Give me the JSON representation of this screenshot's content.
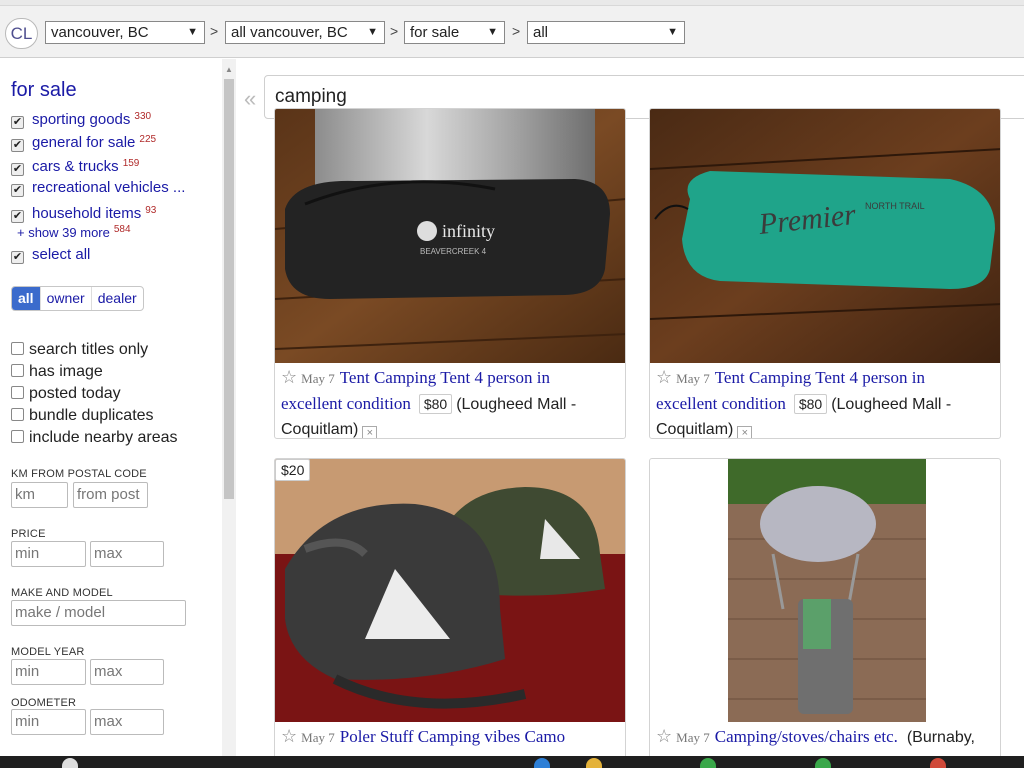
{
  "header": {
    "logo": "CL",
    "location": "vancouver, BC",
    "area": "all vancouver, BC",
    "category": "for sale",
    "subcategory": "all",
    "separator": ">",
    "dropdown_arrow": "▼"
  },
  "sidebar": {
    "title": "for sale",
    "categories": [
      {
        "label": "sporting goods",
        "count": "330"
      },
      {
        "label": "general for sale",
        "count": "225"
      },
      {
        "label": "cars & trucks",
        "count": "159"
      },
      {
        "label": "recreational vehicles ...",
        "count": ""
      },
      {
        "label": "household items",
        "count": "93"
      }
    ],
    "show_more": "+ show 39 more",
    "show_more_count": "584",
    "select_all": "select all",
    "seller_types": [
      "all",
      "owner",
      "dealer"
    ],
    "options": [
      "search titles only",
      "has image",
      "posted today",
      "bundle duplicates",
      "include nearby areas"
    ],
    "km_label": "KM FROM POSTAL CODE",
    "km_placeholder": "km",
    "postal_placeholder": "from post",
    "price_label": "PRICE",
    "min_placeholder": "min",
    "max_placeholder": "max",
    "make_model_label": "MAKE AND MODEL",
    "make_model_placeholder": "make / model",
    "model_year_label": "MODEL YEAR",
    "odometer_label": "ODOMETER"
  },
  "search": {
    "back_icon": "«",
    "query": "camping"
  },
  "results": [
    {
      "date": "May 7",
      "title_line1": "Tent Camping Tent 4 person in",
      "title_line2": "excellent condition",
      "price": "$80",
      "location_part1": "(Lougheed Mall -",
      "location_part2": "Coquitlam)",
      "brand_text": "infinity",
      "brand_sub": "BEAVERCREEK 4"
    },
    {
      "date": "May 7",
      "title_line1": "Tent Camping Tent 4 person in",
      "title_line2": "excellent condition",
      "price": "$80",
      "location_part1": "(Lougheed Mall -",
      "location_part2": "Coquitlam)",
      "brand_text": "Premier",
      "brand_sub": "NORTH TRAIL"
    },
    {
      "price_tag": "$20",
      "date": "May 7",
      "title_line1": "Poler Stuff Camping vibes Camo"
    },
    {
      "date": "May 7",
      "title_line1": "Camping/stoves/chairs etc.",
      "location_part1": "(Burnaby,"
    }
  ],
  "icons": {
    "star": "☆",
    "hide": "×",
    "check": "✔"
  },
  "colors": {
    "link": "#1a1aa6",
    "count": "#b02a2a",
    "active_segment": "#3b6bcc"
  }
}
